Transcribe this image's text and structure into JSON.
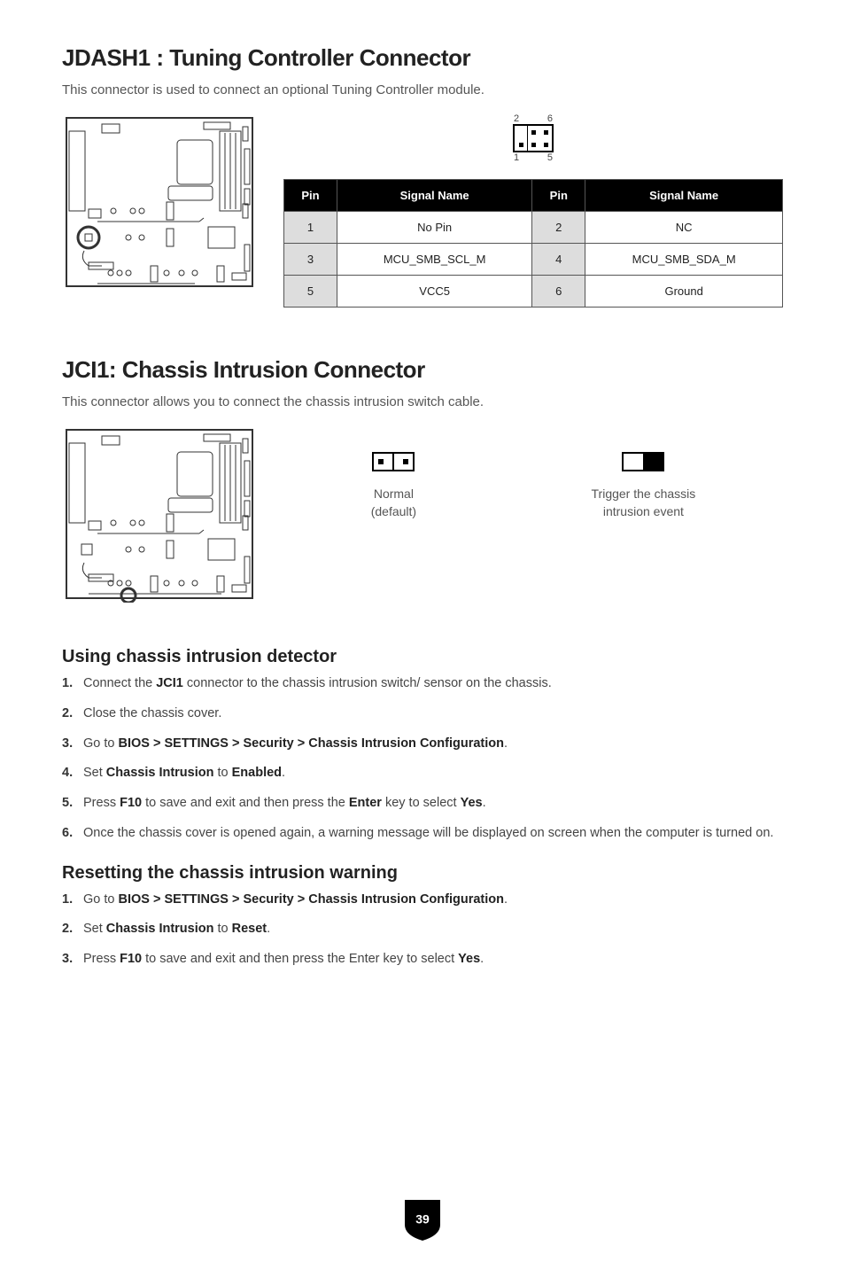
{
  "jdash": {
    "title": "JDASH1 : Tuning Controller Connector",
    "subtitle": "This connector is used to connect an optional Tuning Controller module.",
    "pin_labels": {
      "tl": "2",
      "tr": "6",
      "bl": "1",
      "br": "5"
    },
    "table": {
      "headers": [
        "Pin",
        "Signal Name",
        "Pin",
        "Signal Name"
      ],
      "rows": [
        [
          "1",
          "No Pin",
          "2",
          "NC"
        ],
        [
          "3",
          "MCU_SMB_SCL_M",
          "4",
          "MCU_SMB_SDA_M"
        ],
        [
          "5",
          "VCC5",
          "6",
          "Ground"
        ]
      ]
    }
  },
  "jci": {
    "title": "JCI1: Chassis Intrusion Connector",
    "subtitle": "This connector allows you to connect the chassis intrusion switch cable.",
    "normal_label_l1": "Normal",
    "normal_label_l2": "(default)",
    "trigger_label_l1": "Trigger the chassis",
    "trigger_label_l2": "intrusion event"
  },
  "using": {
    "title": "Using chassis intrusion detector",
    "steps": [
      "Connect the <b>JCI1</b> connector to the chassis intrusion switch/ sensor on the chassis.",
      "Close the chassis cover.",
      "Go to <b>BIOS > SETTINGS > Security > Chassis Intrusion Configuration</b>.",
      "Set <b>Chassis Intrusion</b> to <b>Enabled</b>.",
      "Press <b>F10</b> to save and exit and then press the <b>Enter</b> key to select <b>Yes</b>.",
      "Once the chassis cover is opened again, a warning message will be displayed on screen when the computer is turned on."
    ]
  },
  "reset": {
    "title": "Resetting the chassis intrusion warning",
    "steps": [
      "Go to <b>BIOS > SETTINGS > Security > Chassis Intrusion Configuration</b>.",
      "Set <b>Chassis Intrusion</b> to <b>Reset</b>.",
      "Press <b>F10</b> to save and exit and then press the Enter key to select <b>Yes</b>."
    ]
  },
  "page_number": "39"
}
